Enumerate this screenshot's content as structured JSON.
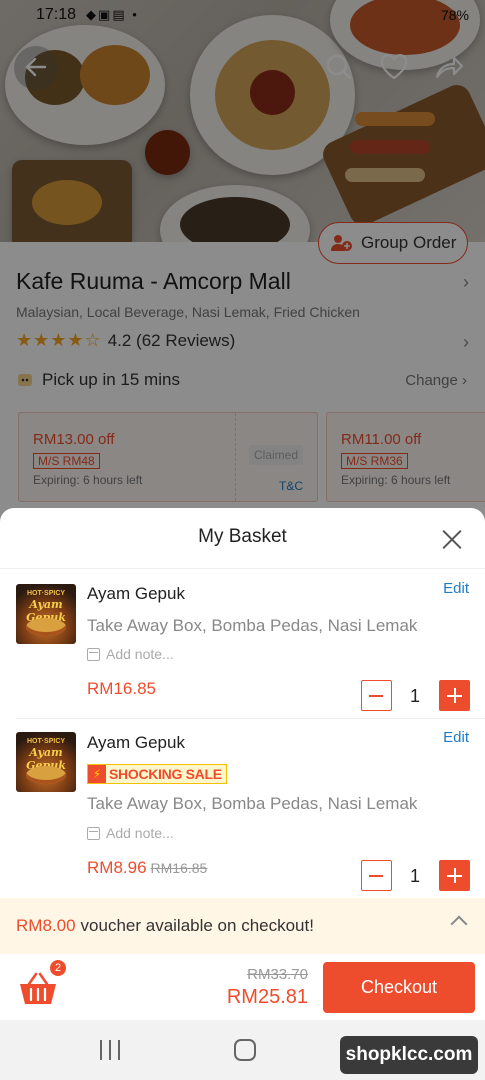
{
  "status_bar": {
    "time": "17:18",
    "right": "78%"
  },
  "shop": {
    "name": "Kafe Ruuma - Amcorp Mall",
    "categories": "Malaysian, Local Beverage, Nasi Lemak, Fried Chicken",
    "stars": "★★★★☆",
    "rating": "4.2 (62 Reviews)",
    "rating_value": 4.2,
    "pickup": "Pick up in 15 mins",
    "change_label": "Change",
    "group_order_label": "Group Order"
  },
  "vouchers": [
    {
      "amount": "RM13.00 off",
      "min_spend": "M/S RM48",
      "expiry": "Expiring: 6 hours left",
      "claimed": "Claimed",
      "tnc": "T&C"
    },
    {
      "amount": "RM11.00 off",
      "min_spend": "M/S RM36",
      "expiry": "Expiring: 6 hours left"
    }
  ],
  "basket": {
    "title": "My Basket",
    "items": [
      {
        "thumb_line1": "HOT·SPICY",
        "thumb_line2": "Ayam Gepuk",
        "name": "Ayam Gepuk",
        "edit_label": "Edit",
        "options": "Take Away Box, Bomba Pedas, Nasi Lemak",
        "note_placeholder": "Add note...",
        "price": "RM16.85",
        "quantity": "1"
      },
      {
        "thumb_line1": "HOT·SPICY",
        "thumb_line2": "Ayam Gepuk",
        "name": "Ayam Gepuk",
        "edit_label": "Edit",
        "badge": "SHOCKING SALE",
        "options": "Take Away Box, Bomba Pedas, Nasi Lemak",
        "note_placeholder": "Add note...",
        "price": "RM8.96",
        "original_price": "RM16.85",
        "quantity": "1"
      }
    ],
    "voucher_bar": {
      "amount": "RM8.00",
      "text": "voucher available on checkout!"
    },
    "cart_count": "2",
    "original_total": "RM33.70",
    "total": "RM25.81",
    "checkout_label": "Checkout"
  },
  "watermark": "shopklcc.com",
  "colors": {
    "accent": "#ee4d2d",
    "link": "#1e7cc5",
    "voucher_bg": "#fff6e6",
    "sale_badge": "#f5c000"
  },
  "icons": [
    "back-arrow-icon",
    "search-icon",
    "heart-icon",
    "share-icon",
    "group-order-icon",
    "star-icon",
    "chevron-right-icon",
    "pickup-icon",
    "close-icon",
    "note-icon",
    "minus-icon",
    "plus-icon",
    "lightning-icon",
    "chevron-up-icon",
    "basket-icon",
    "nav-recent-icon",
    "nav-home-icon",
    "nav-back-icon"
  ]
}
